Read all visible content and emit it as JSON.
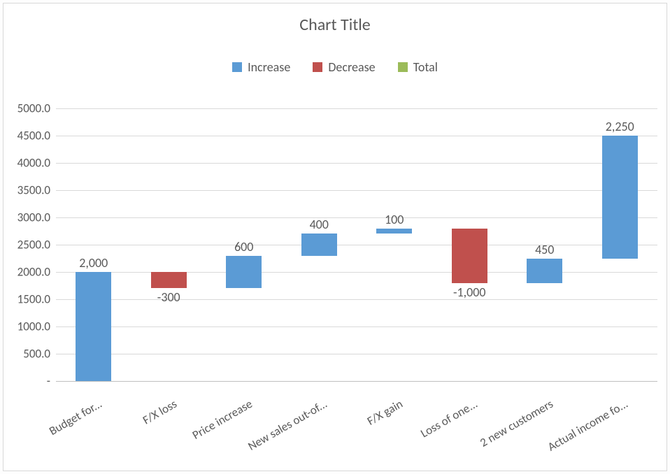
{
  "chart_data": {
    "type": "waterfall",
    "title": "Chart Title",
    "ylim": [
      0,
      5000
    ],
    "y_step": 500,
    "y_ticks": [
      "-",
      "500.0",
      "1000.0",
      "1500.0",
      "2000.0",
      "2500.0",
      "3000.0",
      "3500.0",
      "4000.0",
      "4500.0",
      "5000.0"
    ],
    "categories_display": [
      "Budget for...",
      "F/X loss",
      "Price increase",
      "New sales out-of...",
      "F/X gain",
      "Loss of one...",
      "2 new customers",
      "Actual income fo..."
    ],
    "bars": [
      {
        "label_display": "Budget for...",
        "value": 2000,
        "value_label": "2,000",
        "role": "increase",
        "base": 0,
        "top": 2000
      },
      {
        "label_display": "F/X loss",
        "value": -300,
        "value_label": "-300",
        "role": "decrease",
        "base": 1700,
        "top": 2000
      },
      {
        "label_display": "Price increase",
        "value": 600,
        "value_label": "600",
        "role": "increase",
        "base": 1700,
        "top": 2300
      },
      {
        "label_display": "New sales out-of...",
        "value": 400,
        "value_label": "400",
        "role": "increase",
        "base": 2300,
        "top": 2700
      },
      {
        "label_display": "F/X gain",
        "value": 100,
        "value_label": "100",
        "role": "increase",
        "base": 2700,
        "top": 2800
      },
      {
        "label_display": "Loss of one...",
        "value": -1000,
        "value_label": "-1,000",
        "role": "decrease",
        "base": 1800,
        "top": 2800
      },
      {
        "label_display": "2 new customers",
        "value": 450,
        "value_label": "450",
        "role": "increase",
        "base": 1800,
        "top": 2250
      },
      {
        "label_display": "Actual income fo...",
        "value": 2250,
        "value_label": "2,250",
        "role": "increase",
        "base": 2250,
        "top": 4500
      }
    ],
    "legend": [
      {
        "name": "Increase",
        "color": "#5b9bd5"
      },
      {
        "name": "Decrease",
        "color": "#c0504d"
      },
      {
        "name": "Total",
        "color": "#9bbb59"
      }
    ]
  }
}
